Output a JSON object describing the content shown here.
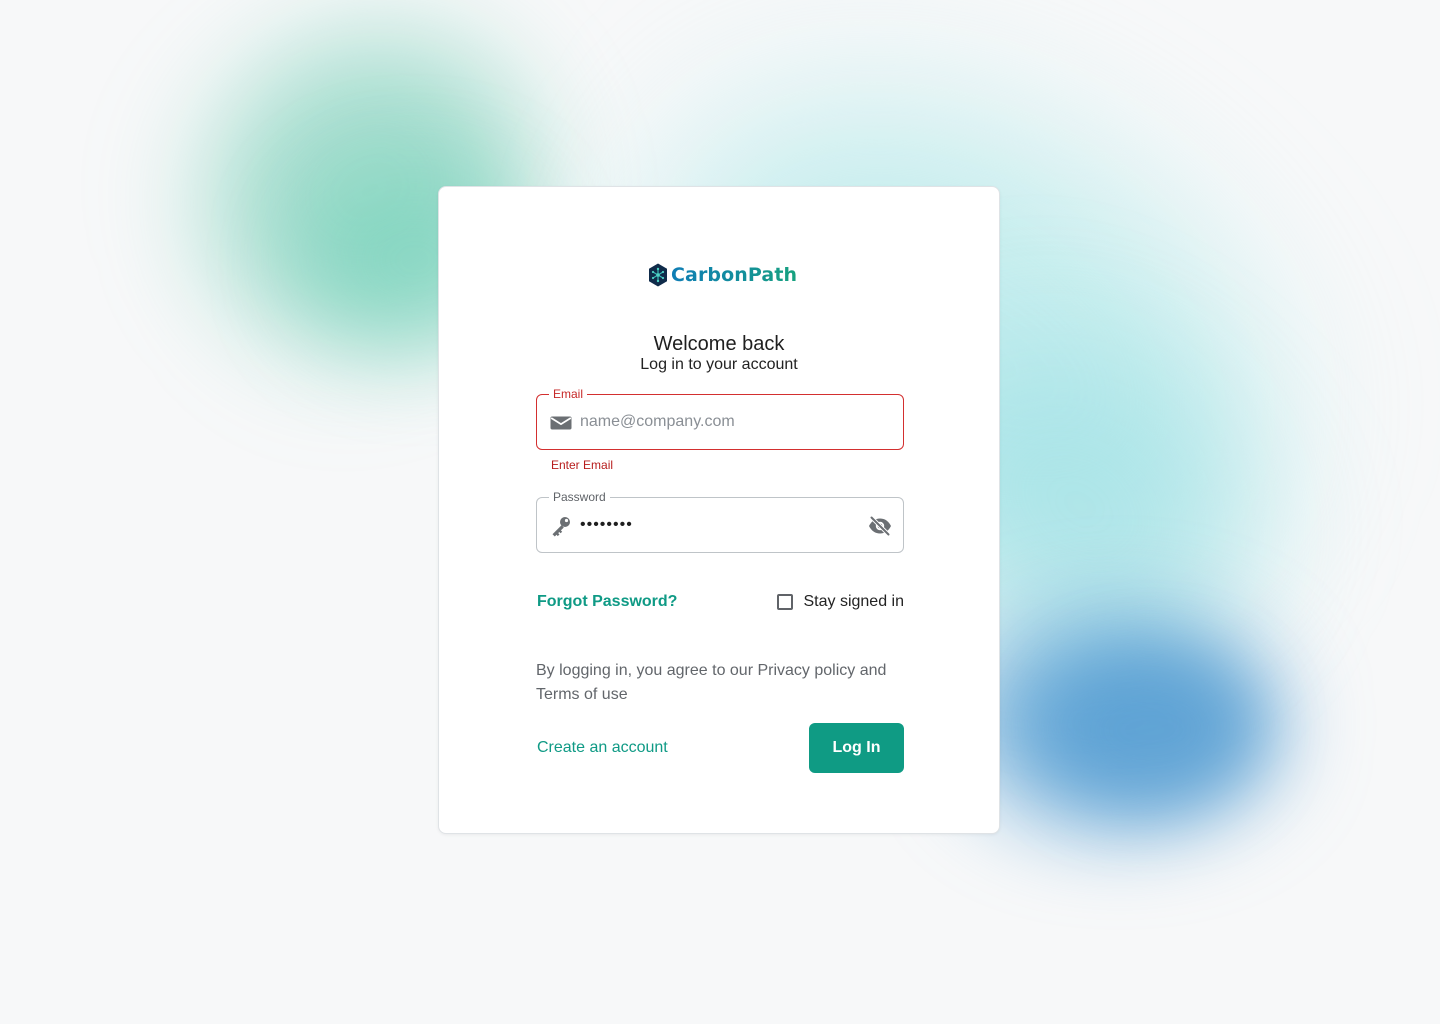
{
  "brand": {
    "name": "CarbonPath",
    "icon": "hexagon-network-logo",
    "gradient_colors": [
      "#0f7db5",
      "#17a27e"
    ]
  },
  "login": {
    "title": "Welcome back",
    "subtitle": "Log in to your account",
    "email": {
      "label": "Email",
      "placeholder": "name@company.com",
      "value": "",
      "error": "Enter Email",
      "icon": "mail-icon",
      "state": "error"
    },
    "password": {
      "label": "Password",
      "value": "••••••••",
      "icon": "key-icon",
      "toggle_icon": "visibility-off-icon"
    },
    "forgot_password_label": "Forgot Password?",
    "stay_signed_in": {
      "label": "Stay signed in",
      "checked": false
    },
    "legal_text": "By logging in, you agree to our Privacy policy and Terms of use",
    "create_account_label": "Create an account",
    "login_button_label": "Log In"
  },
  "colors": {
    "accent": "#0f9b84",
    "error": "#d32f2f",
    "text": "#1f1f1f",
    "muted": "#62666b"
  }
}
